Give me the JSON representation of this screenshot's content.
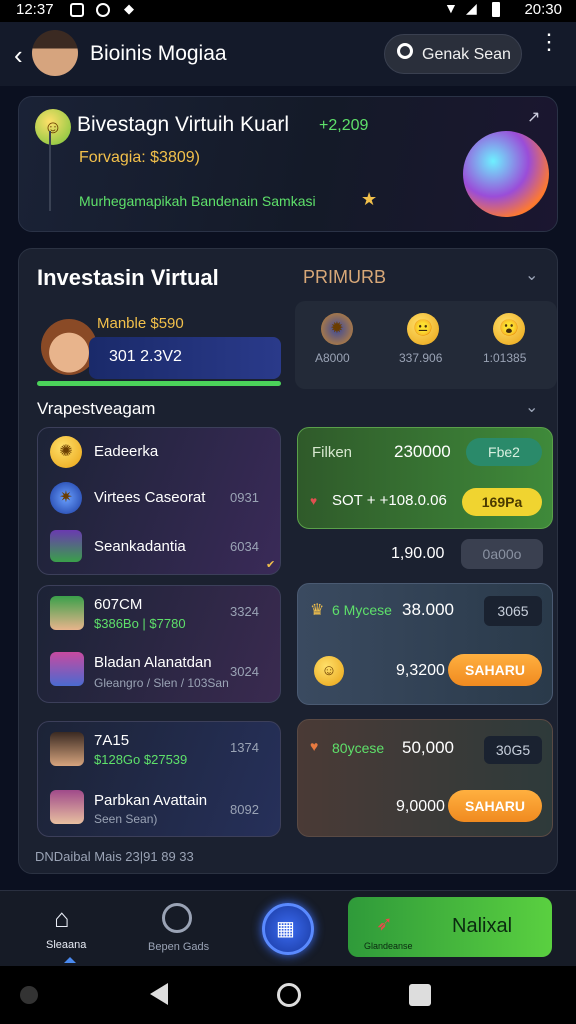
{
  "status": {
    "time_left": "12:37",
    "time_right": "20:30"
  },
  "appbar": {
    "title": "Bioinis Mogiaa",
    "search_label": "Genak Sean"
  },
  "banner": {
    "title": "Bivestagn Virtuih Kuarl",
    "title_value": "+2,209",
    "subtitle": "Forvagia: $3809)",
    "line": "Murhegamapikah Bandenain Samkasi"
  },
  "section": {
    "title": "Investasin Virtual",
    "premium": "PRIMURB",
    "profile_label": "Manble $590",
    "profile_value": "301 2.3V2",
    "stats": [
      {
        "icon": "astronaut-icon",
        "value": "A8000"
      },
      {
        "icon": "neutral-face-icon",
        "value": "337.906"
      },
      {
        "icon": "surprised-face-icon",
        "value": "1:01385"
      }
    ],
    "sub_title": "Vrapestveagam"
  },
  "lists": [
    {
      "items": [
        {
          "icon": "sun-coin-icon",
          "name": "Eadeerka",
          "value": ""
        },
        {
          "icon": "virus-icon",
          "name": "Virtees Caseorat",
          "value": "0931"
        },
        {
          "icon": "character-icon",
          "name": "Seankadantia",
          "value": "6034"
        }
      ]
    },
    {
      "items": [
        {
          "icon": "person-icon",
          "name": "607CM",
          "sub": "$386Bo | $7780",
          "value": "3324"
        },
        {
          "icon": "robot-icon",
          "name": "Bladan Alanatdan",
          "sub": "Gleangro / Slen / 103San",
          "value": "3024"
        }
      ]
    },
    {
      "items": [
        {
          "icon": "woman-icon",
          "name": "7A15",
          "sub": "$128Go $27539",
          "value": "1374"
        },
        {
          "icon": "woman-icon",
          "name": "Parbkan Avattain",
          "sub": "Seen Sean)",
          "value": "8092"
        }
      ]
    }
  ],
  "right_cards": [
    {
      "label": "Filken",
      "value": "230000",
      "btn": "Fbe2",
      "row2": "SOT + +108.0.06",
      "btn2": "169Pa",
      "below_value": "1,90.00",
      "below_btn": "0a00o"
    },
    {
      "label": "6 Mycese",
      "value": "38.000",
      "badge": "3065",
      "row2_value": "9,3200",
      "btn2": "SAHARU"
    },
    {
      "label": "80ycese",
      "value": "50,000",
      "badge": "30G5",
      "row2_value": "9,0000",
      "btn2": "SAHARU"
    }
  ],
  "footer_text": "DNDaibal Mais 23|91 89 33",
  "nav": {
    "home": "Sleaana",
    "second": "Bepen Gads",
    "cta": "Nalixal",
    "cta_sub": "Glandeanse"
  }
}
